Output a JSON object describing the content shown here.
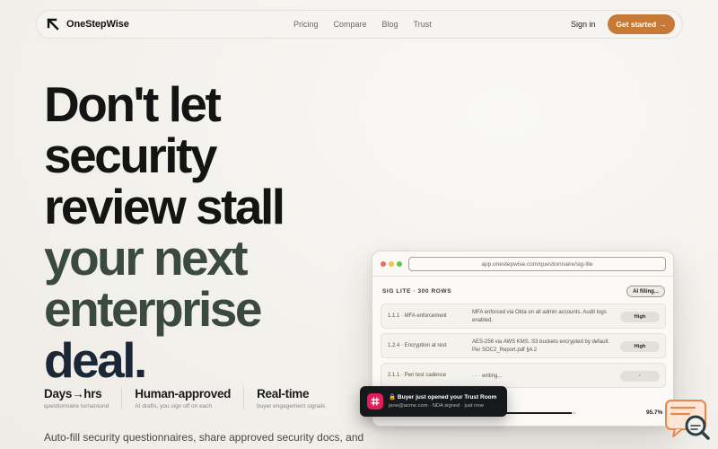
{
  "brand": {
    "name": "OneStepWise"
  },
  "nav": {
    "links": [
      "Pricing",
      "Compare",
      "Blog",
      "Trust"
    ],
    "signin": "Sign in",
    "cta": "Get started",
    "cta_arrow": "→"
  },
  "hero": {
    "lines": [
      "Don't let",
      "security",
      "review stall",
      "your next",
      "enterprise",
      "deal."
    ],
    "subtext": "Auto-fill security questionnaires, share approved security docs, and"
  },
  "stats": [
    {
      "title": "Days→hrs",
      "sub": "questionnaire turnaround"
    },
    {
      "title": "Human-approved",
      "sub": "AI drafts, you sign off on each"
    },
    {
      "title": "Real-time",
      "sub": "buyer engagement signals"
    }
  ],
  "app_window": {
    "url": "app.onestepwise.com/questionnaire/sig-lite",
    "sheet_title": "SIG LITE · 300 ROWS",
    "ai_status": "AI filling...",
    "rows": [
      {
        "id": "1.1.1 · MFA enforcement",
        "answer": "MFA enforced via Okta on all admin accounts. Audit logs enabled.",
        "badge": "High"
      },
      {
        "id": "1.2.4 · Encryption at rest",
        "answer": "AES-256 via AWS KMS. S3 buckets encrypted by default. Per SOC2_Report.pdf §4.2",
        "badge": "High"
      },
      {
        "id": "2.1.1 · Pen test cadence",
        "answer": "· · · writing...",
        "badge": "·"
      }
    ],
    "progress_value": 95.7,
    "progress_label": "95.7%"
  },
  "toast": {
    "title": "🔒 Buyer just opened your Trust Room",
    "sub": "jane@acme.com · NDA signed · just now"
  },
  "colors": {
    "background": "#f3f1ec",
    "accent": "#c77a35",
    "headline_green": "#3b4a40",
    "headline_navy": "#1a2736",
    "toast_bg": "#16181c",
    "slack_pink": "#e01e5a",
    "chat_orange": "#e8874a"
  },
  "icons": {
    "logo": "arrow-up-left-icon",
    "toast": "slack-icon",
    "chat": "chat-search-icon"
  }
}
